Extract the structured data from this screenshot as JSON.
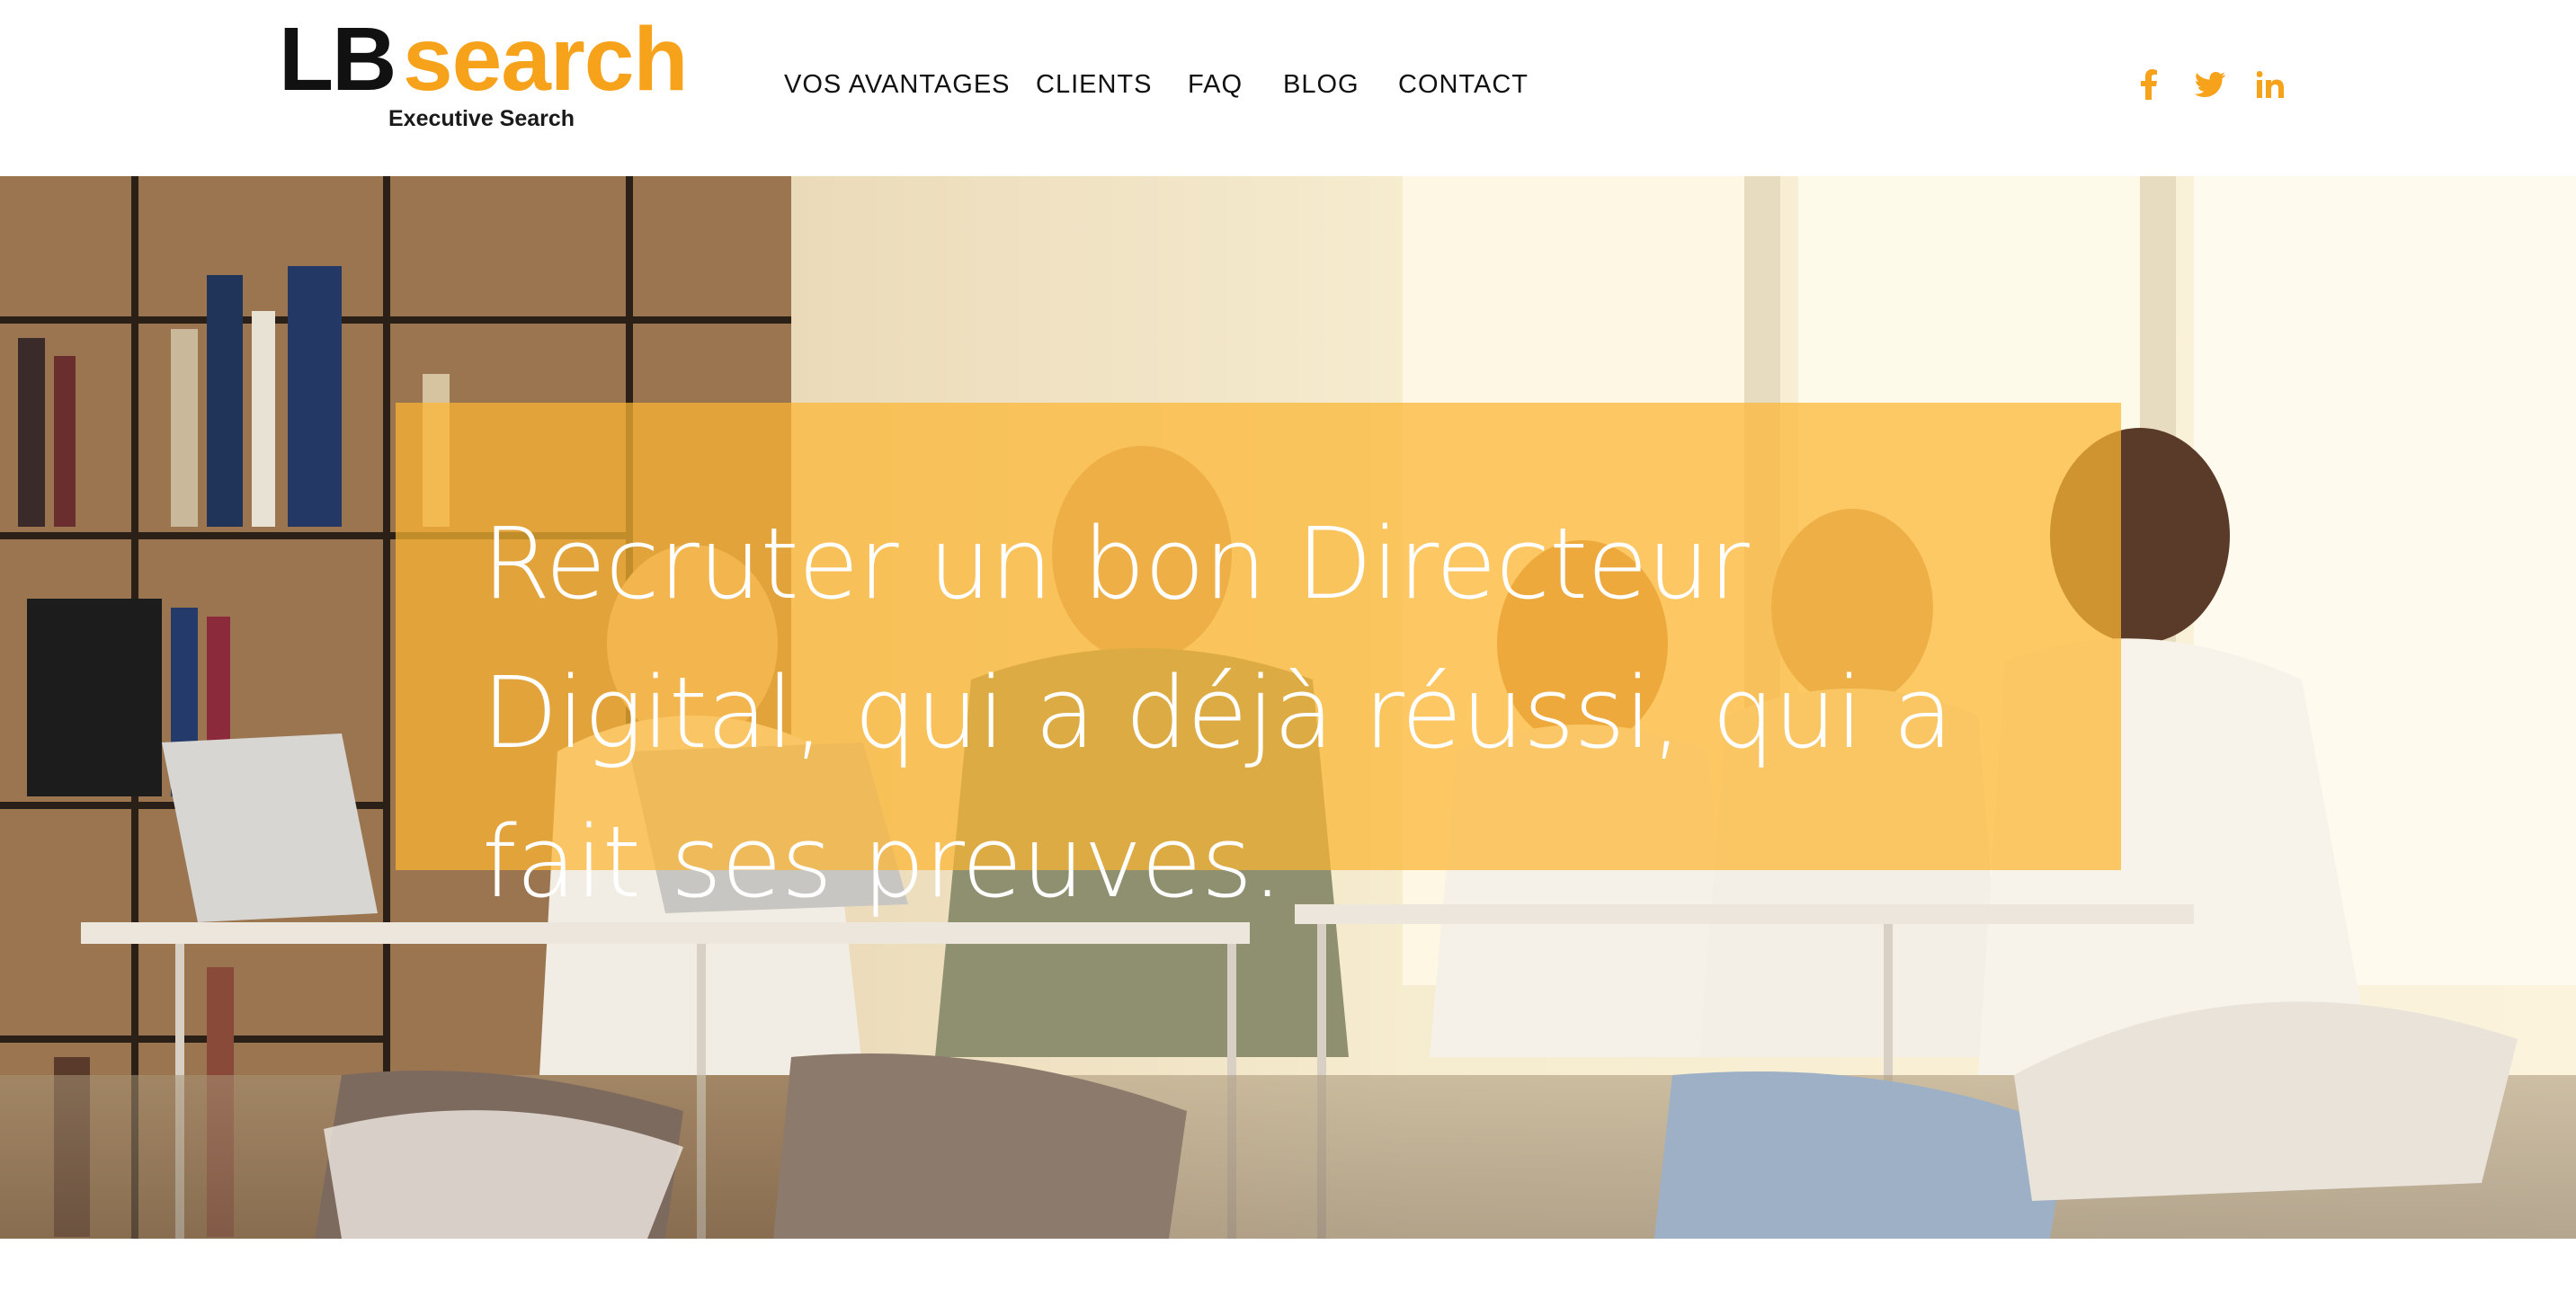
{
  "logo": {
    "part1": "LB",
    "part2": "search",
    "subtitle": "Executive Search"
  },
  "nav": {
    "items": [
      {
        "label": "VOS AVANTAGES"
      },
      {
        "label": "CLIENTS"
      },
      {
        "label": "FAQ"
      },
      {
        "label": "BLOG"
      },
      {
        "label": "CONTACT"
      }
    ]
  },
  "social": {
    "icons": [
      "facebook-icon",
      "twitter-icon",
      "linkedin-icon"
    ],
    "color": "#f7a21b"
  },
  "hero": {
    "title": "Recruter un bon Directeur Digital, qui a déjà réussi, qui a fait ses preuves.",
    "overlay_color": "#fcb632"
  }
}
